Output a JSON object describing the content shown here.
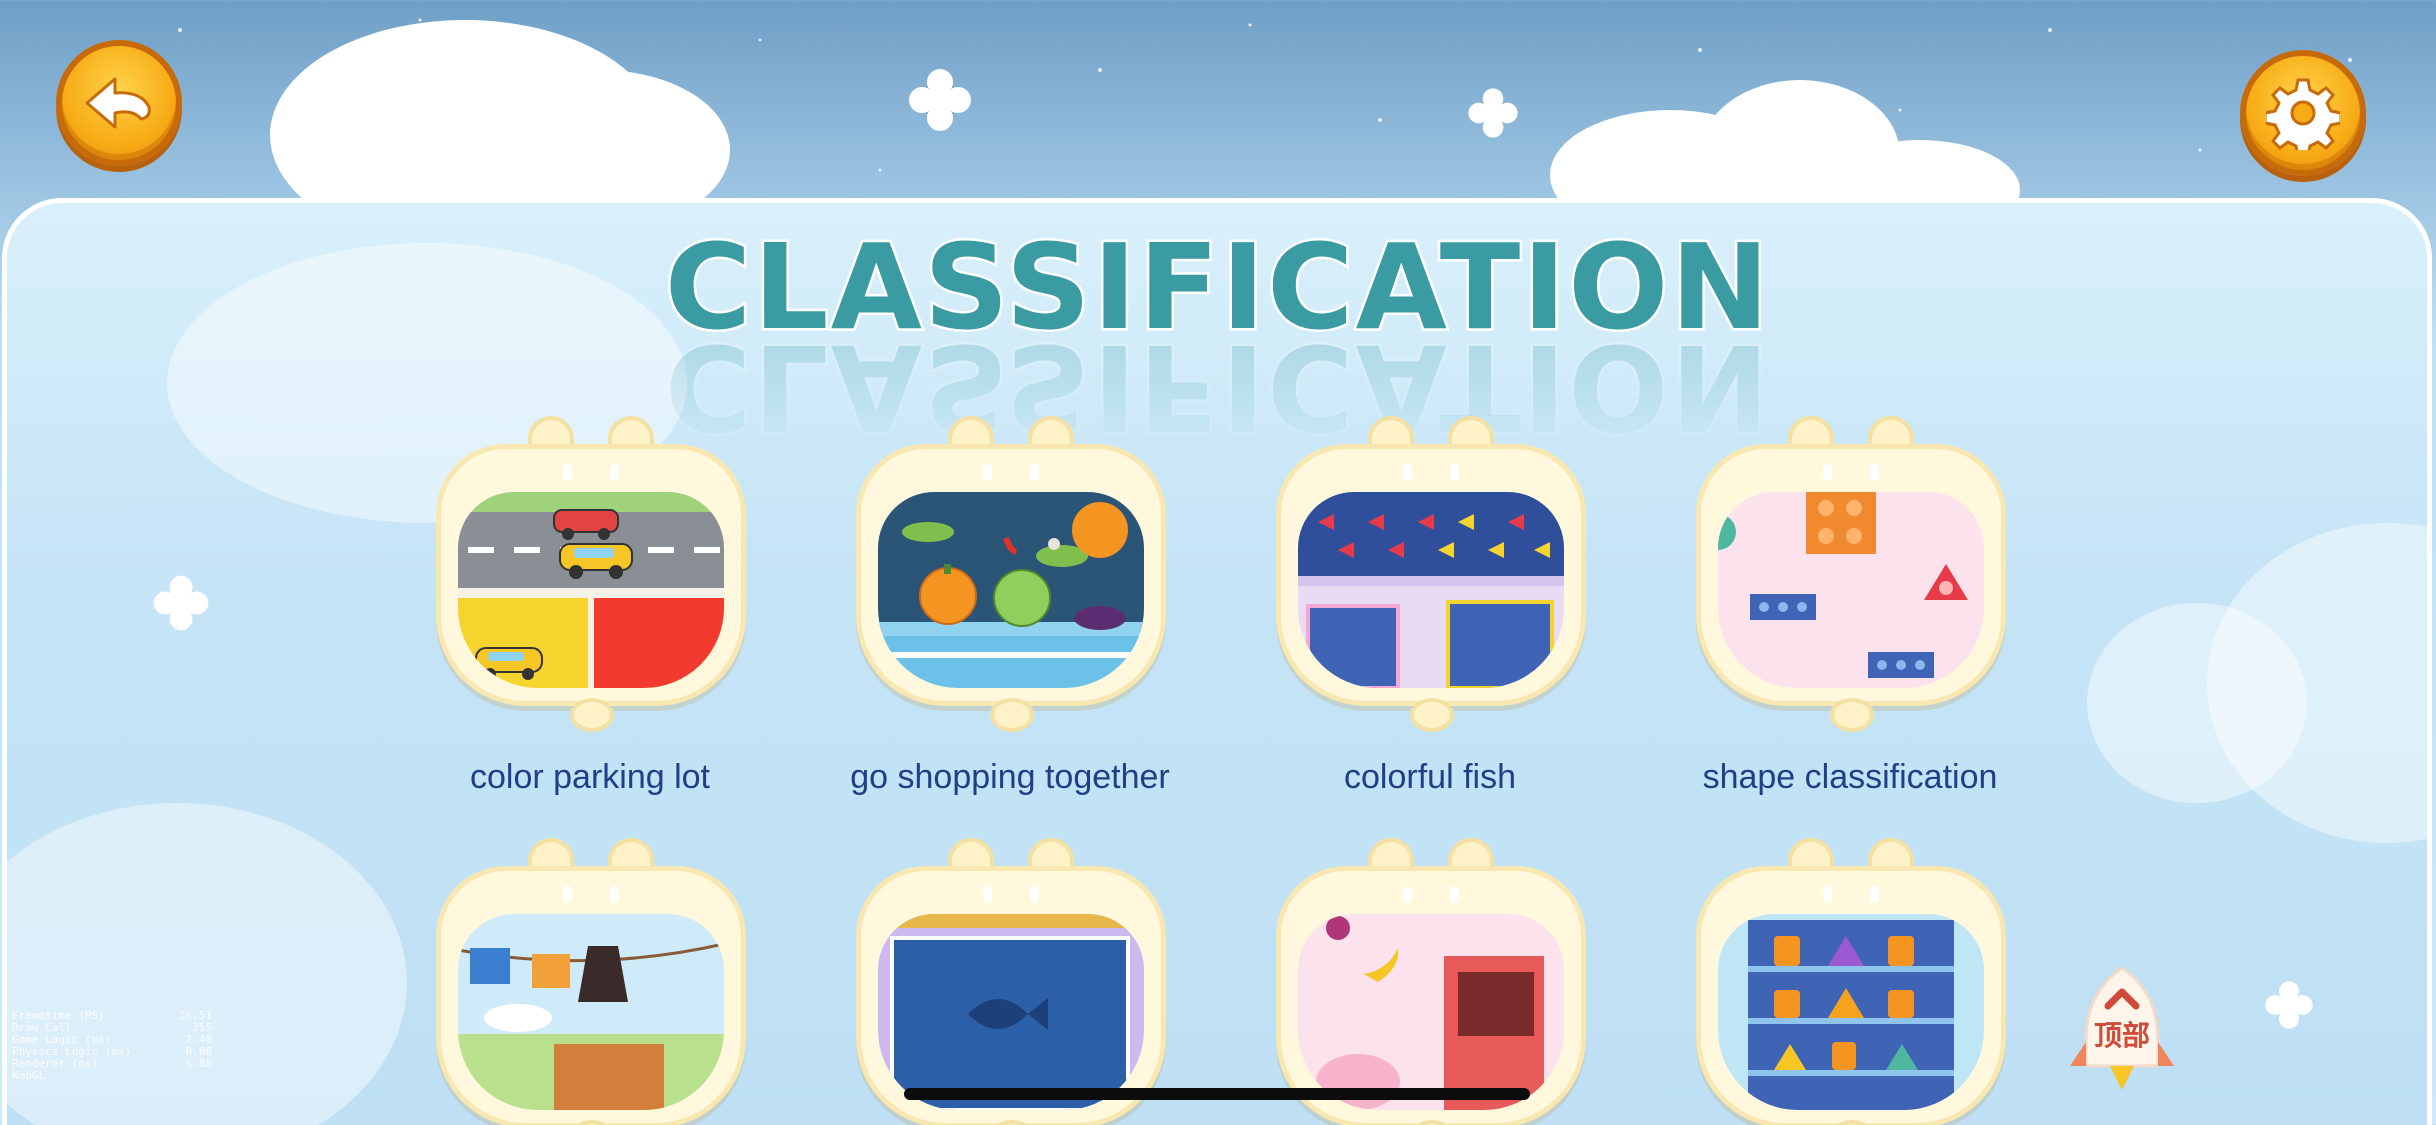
{
  "header": {
    "title": "CLASSIFICATION",
    "back_icon": "back-arrow-icon",
    "settings_icon": "gear-icon"
  },
  "games": [
    {
      "label": "color parking lot",
      "scene": "cars-road-parking"
    },
    {
      "label": "go shopping together",
      "scene": "vegetables-shelf"
    },
    {
      "label": "colorful fish",
      "scene": "fish-tanks"
    },
    {
      "label": "shape classification",
      "scene": "shapes-wall"
    },
    {
      "label": "",
      "scene": "clothes-line"
    },
    {
      "label": "",
      "scene": "fish-bowl"
    },
    {
      "label": "",
      "scene": "fruits-basket"
    },
    {
      "label": "",
      "scene": "shelves-jars-shapes"
    }
  ],
  "top_button": {
    "label": "顶部",
    "icon": "chevron-up-icon"
  },
  "debug_overlay": [
    {
      "key": "Frametime (MS)",
      "value": "16.51"
    },
    {
      "key": "Draw Call",
      "value": "355"
    },
    {
      "key": "Game Logic (ms)",
      "value": "7.40"
    },
    {
      "key": "Physics Logic (ms)",
      "value": "0.00"
    },
    {
      "key": "Renderer (ms)",
      "value": "6.88"
    },
    {
      "key": "WebGL",
      "value": ""
    }
  ],
  "colors": {
    "title": "#3a9ba3",
    "label": "#1f3f86",
    "button_orange": "#f7ac16",
    "card_frame": "#fff8dc"
  }
}
